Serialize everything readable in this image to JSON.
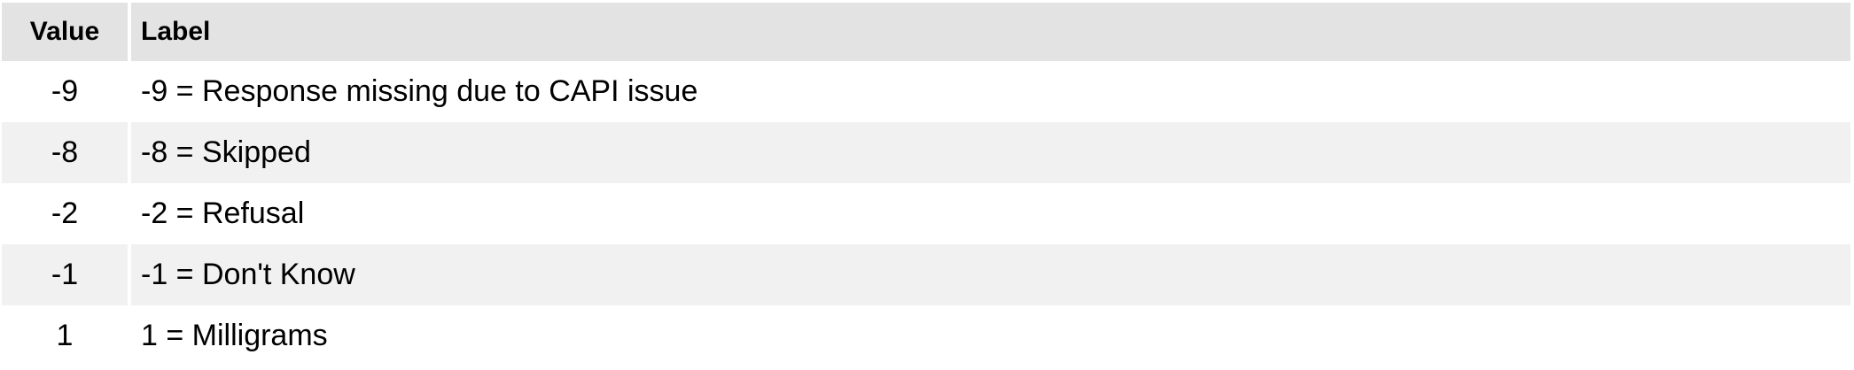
{
  "table": {
    "headers": {
      "value": "Value",
      "label": "Label"
    },
    "rows": [
      {
        "value": "-9",
        "label": "-9 = Response missing due to CAPI issue"
      },
      {
        "value": "-8",
        "label": "-8 = Skipped"
      },
      {
        "value": "-2",
        "label": "-2 = Refusal"
      },
      {
        "value": "-1",
        "label": "-1 = Don't Know"
      },
      {
        "value": "1",
        "label": "1 = Milligrams"
      }
    ]
  },
  "colors": {
    "header_bg": "#e3e3e3",
    "row_odd_bg": "#ffffff",
    "row_even_bg": "#f1f1f1",
    "text": "#000000"
  }
}
